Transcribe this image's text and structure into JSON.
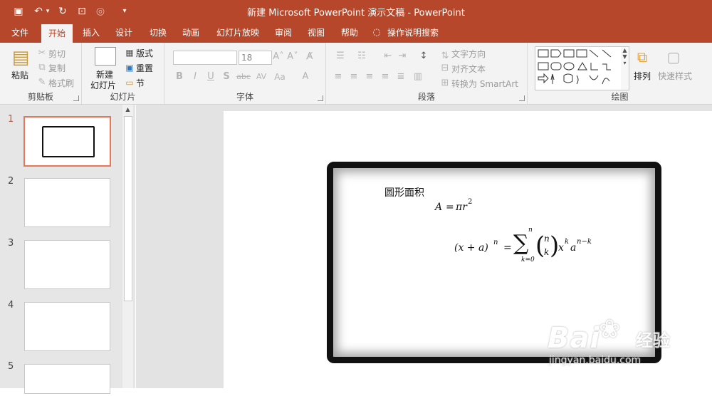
{
  "window": {
    "title": "新建 Microsoft PowerPoint 演示文稿  -  PowerPoint"
  },
  "quick_access": {
    "save_icon": "save-icon",
    "undo_icon": "undo-icon",
    "redo_icon": "redo-icon"
  },
  "tabs": [
    "文件",
    "开始",
    "插入",
    "设计",
    "切换",
    "动画",
    "幻灯片放映",
    "审阅",
    "视图",
    "帮助",
    "操作说明搜索"
  ],
  "ribbon": {
    "clipboard": {
      "label": "剪贴板",
      "paste": "粘贴",
      "cut": "剪切",
      "copy": "复制",
      "format_painter": "格式刷"
    },
    "slides": {
      "label": "幻灯片",
      "new_slide": "新建",
      "new_slide_2": "幻灯片",
      "layout": "版式",
      "reset": "重置",
      "section": "节"
    },
    "font": {
      "label": "字体",
      "font_name": "",
      "font_size": "18",
      "bold": "B",
      "italic": "I",
      "underline": "U",
      "shadow": "S",
      "strike": "abc",
      "spacing": "AV",
      "case": "Aa",
      "color": "A"
    },
    "paragraph": {
      "label": "段落",
      "text_direction": "文字方向",
      "align_text": "对齐文本",
      "smartart": "转换为 SmartArt"
    },
    "drawing": {
      "label": "绘图",
      "arrange": "排列",
      "quick_styles": "快速样式"
    }
  },
  "slides_panel": {
    "numbers": [
      "1",
      "2",
      "3",
      "4",
      "5"
    ],
    "selected": "1"
  },
  "slide": {
    "heading": "圆形面积",
    "formula1": {
      "lhs": "A",
      "eq": "=",
      "rhs": "πr",
      "sup": "2"
    },
    "formula2": {
      "lhs": "(x + a)",
      "sup_n": "n",
      "eq": "=",
      "sigma": "∑",
      "upper": "n",
      "lower": "k=0",
      "binom_top": "n",
      "binom_bottom": "k",
      "term": "x",
      "sup_k": "k",
      "term2": "a",
      "sup_nk": "n−k"
    }
  },
  "watermark": {
    "text": "Bai",
    "cn": "经验",
    "url": "jingyan.baidu.com"
  }
}
